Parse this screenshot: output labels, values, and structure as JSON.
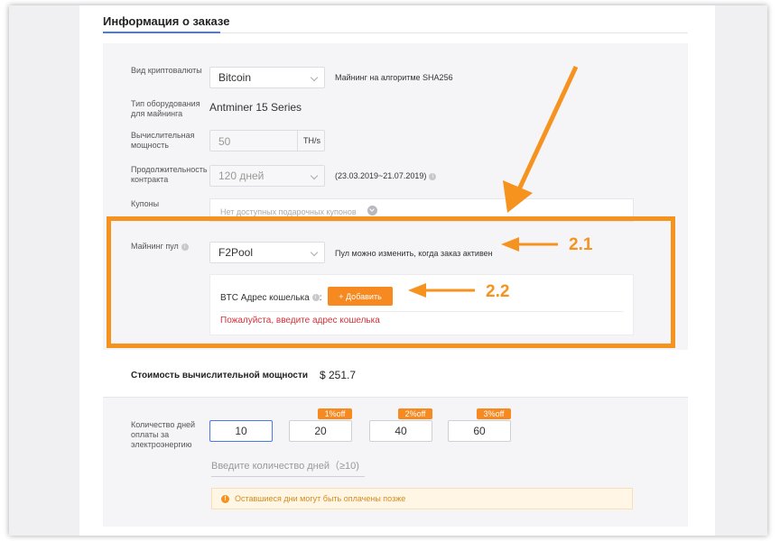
{
  "section": {
    "title": "Информация о заказе"
  },
  "crypto": {
    "label": "Вид криптовалюты",
    "value": "Bitcoin",
    "note": "Майнинг на алгоритме SHA256"
  },
  "equipment": {
    "label": "Тип оборудования для майнинга",
    "value": "Antminer 15 Series"
  },
  "power": {
    "label": "Вычислительная мощность",
    "value": "50",
    "unit": "TH/s"
  },
  "contract": {
    "label": "Продолжительность контракта",
    "value": "120 дней",
    "range": "(23.03.2019~21.07.2019)"
  },
  "coupons": {
    "label": "Купоны",
    "placeholder": "Нет доступных подарочных купонов"
  },
  "pool": {
    "label": "Майнинг пул",
    "value": "F2Pool",
    "note": "Пул можно изменить, когда заказ активен"
  },
  "wallet": {
    "label": "BTC Адрес кошелька",
    "colon": ":",
    "add_button": "+ Добавить",
    "error": "Пожалуйста, введите адрес кошелька"
  },
  "cost": {
    "label": "Стоимость вычислительной мощности",
    "value": "$ 251.7"
  },
  "days": {
    "label": "Количество дней оплаты за электроэнергию",
    "options": [
      {
        "value": "10",
        "discount": ""
      },
      {
        "value": "20",
        "discount": "1%off"
      },
      {
        "value": "40",
        "discount": "2%off"
      },
      {
        "value": "60",
        "discount": "3%off"
      }
    ],
    "input_placeholder": "Введите количество дней（≥10)",
    "warning": "Оставшиеся дни могут быть оплачены позже"
  },
  "annotations": {
    "label_1": "2.1",
    "label_2": "2.2"
  },
  "colors": {
    "accent": "#f6891f",
    "highlight": "#f6921e",
    "link_blue": "#4a78e6",
    "error": "#d0333b"
  }
}
